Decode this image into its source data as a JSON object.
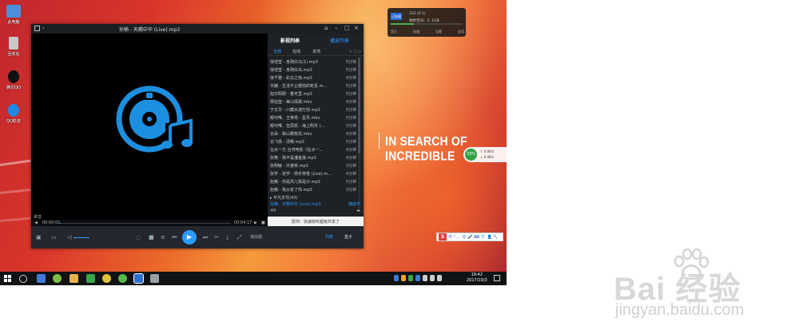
{
  "desktop": {
    "icons": [
      {
        "label": "此电脑",
        "color": "#4a90d9"
      },
      {
        "label": "回收站",
        "color": "#c8c8c8"
      },
      {
        "label": "腾讯QQ",
        "color": "#111111"
      },
      {
        "label": "QQ影音",
        "color": "#1e88e5"
      }
    ],
    "slogan": "IN SEARCH OF INCREDIBLE"
  },
  "net_widget": {
    "chip": "已加速",
    "line1": "332 (0.1)",
    "line2": "剩余空间：3. 1GB",
    "usage_fraction": 0.32,
    "buttons": [
      "音乐",
      "加速",
      "设置",
      "应用"
    ]
  },
  "speed_widget": {
    "percent": "33%",
    "up": "0.0K/s",
    "down": "0.0K/s"
  },
  "player": {
    "title": "孙楠 - 天赐中华 (Live).mp3",
    "video_label": "歌音",
    "time_elapsed": "00:00:01",
    "time_total": "00:04:17",
    "progress_fraction": 0.004,
    "controls": {
      "labels": [
        "播放器",
        "列表",
        "盒子"
      ]
    },
    "panel": {
      "tabs": [
        "影视列表",
        "播放列表"
      ],
      "subtabs": [
        "全部",
        "在线",
        "本地"
      ],
      "items": [
        {
          "name": "徐佳莹 - 身骑白马(1).mp3",
          "dur": "5分钟"
        },
        {
          "name": "徐佳莹 - 身骑白马.mp3",
          "dur": "5分钟"
        },
        {
          "name": "徐千雅 - 彩云之南.mp3",
          "dur": "4分钟"
        },
        {
          "name": "许巍 - 生活不止眼前的苟且.m...",
          "dur": "5分钟"
        },
        {
          "name": "旭日阳刚 - 春天里.mp3",
          "dur": "5分钟"
        },
        {
          "name": "杨钰莹 - 美山情歌.mkv",
          "dur": "4分钟"
        },
        {
          "name": "于文华 - 川藏水波打捞.mp3",
          "dur": "5分钟"
        },
        {
          "name": "郁可唯、王铮亮 - 星月.mkv",
          "dur": "5分钟"
        },
        {
          "name": "郁可唯、伍思凯 - 海上明月 (...",
          "dur": "3分钟"
        },
        {
          "name": "云朵 - 梨山樱桃花.mkv",
          "dur": "4分钟"
        },
        {
          "name": "云飞扬 - 清畅.mp3",
          "dur": "5分钟"
        },
        {
          "name": "在水一方 台湾电影《在水一...",
          "dur": "4分钟"
        },
        {
          "name": "张艳 - 我不是潘金莲.mp3",
          "dur": "4分钟"
        },
        {
          "name": "张明敏 - 外婆桥.mp3",
          "dur": "3分钟"
        },
        {
          "name": "张学 - 张学 - 杨手穿搭 (Live).m...",
          "dur": "4分钟"
        },
        {
          "name": "赵薇 - 你是风儿我是沙.mp3",
          "dur": "5分钟"
        },
        {
          "name": "赵薇 - 我从有了你.mp3",
          "dur": "3分钟"
        }
      ],
      "group": "▸ 平凡岁月(43)",
      "current": {
        "name": "孙楠 - 天赐中华 (Live).mp3",
        "status": "播放中",
        "quality": "4M"
      },
      "share": "愿你：快速收听超级共享了"
    }
  },
  "ime": {
    "logo": "S",
    "glyphs": "中 ° ， ☺ 🎤 ⌨ 👕 👤 🔧"
  },
  "taskbar": {
    "time": "19:42",
    "date": "2017/10/3"
  },
  "watermark": {
    "brand": "Bai 经验",
    "url": "jingyan.baidu.com"
  }
}
